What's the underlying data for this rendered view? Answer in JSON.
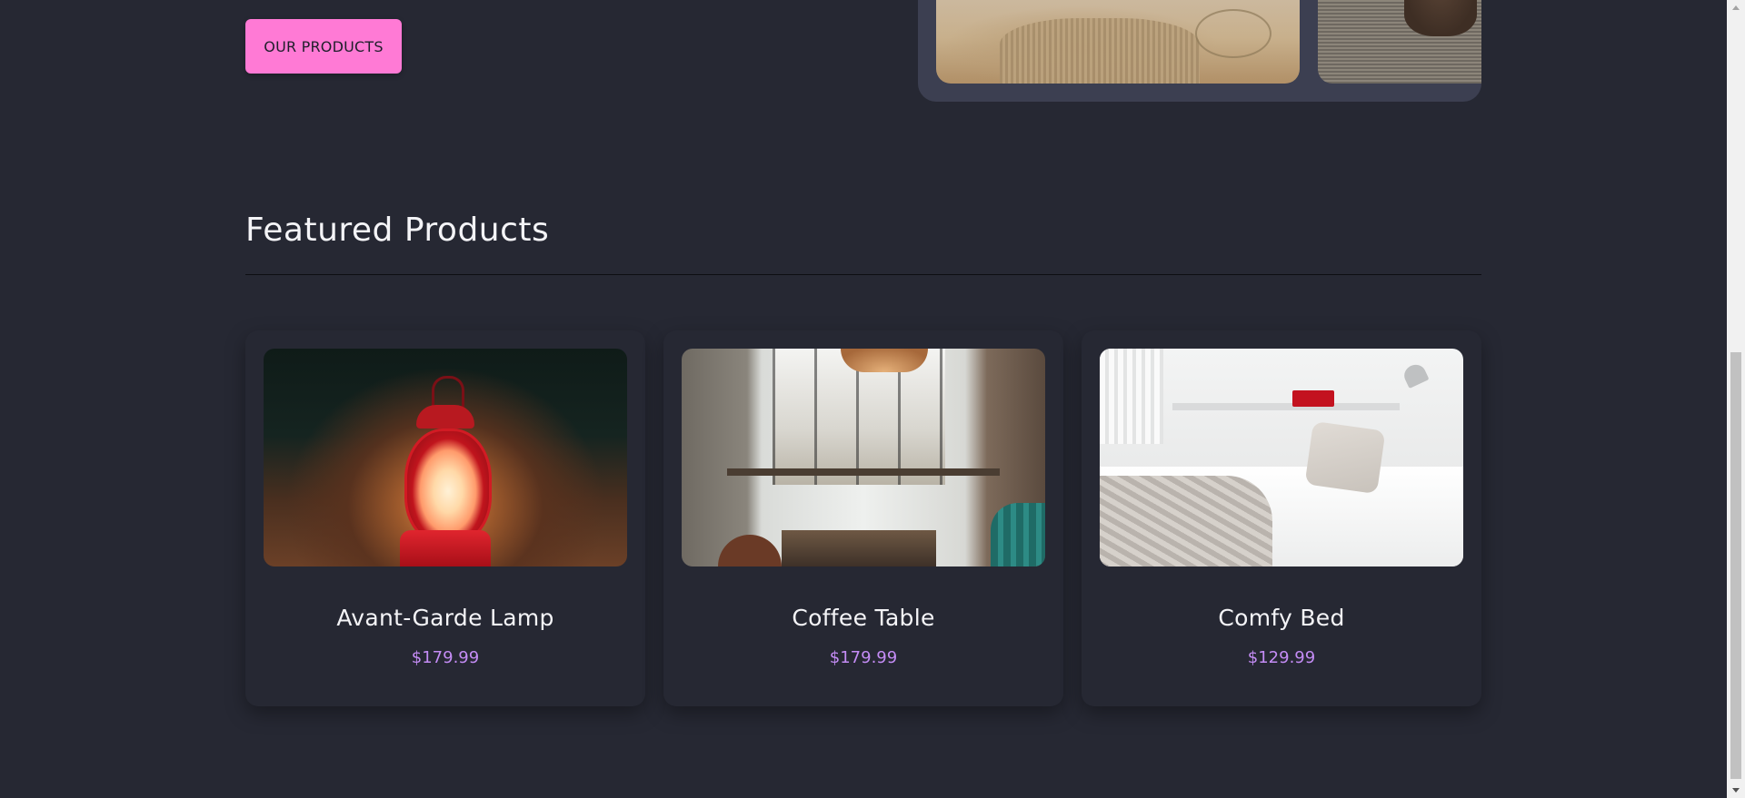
{
  "hero": {
    "cta_label": "OUR PRODUCTS"
  },
  "featured": {
    "title": "Featured Products",
    "products": [
      {
        "name": "Avant-Garde Lamp",
        "price": "$179.99"
      },
      {
        "name": "Coffee Table",
        "price": "$179.99"
      },
      {
        "name": "Comfy Bed",
        "price": "$129.99"
      }
    ]
  },
  "theme": {
    "background": "#262833",
    "accent_button": "#ff7ad5",
    "price_color": "#c48cf5"
  }
}
